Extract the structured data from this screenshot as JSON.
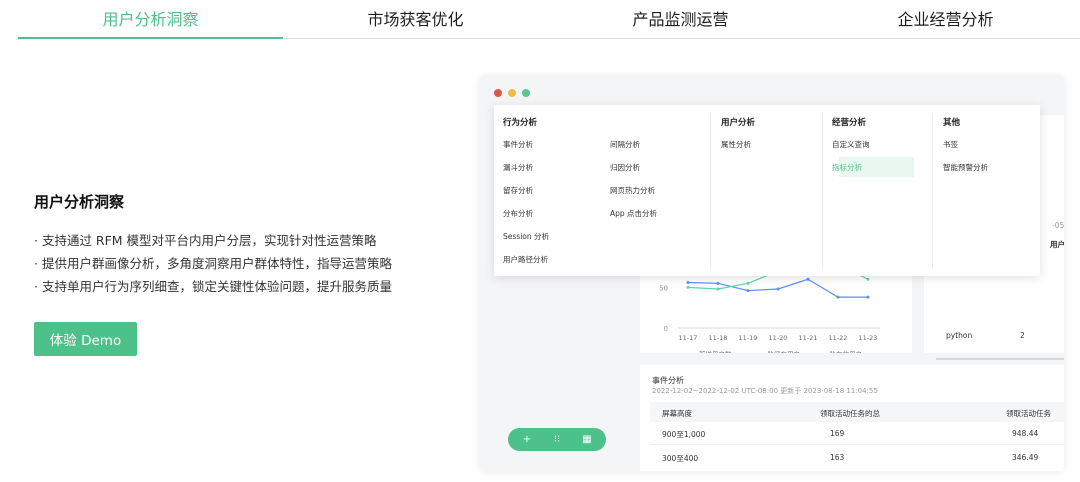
{
  "tabs": [
    {
      "label": "用户分析洞察"
    },
    {
      "label": "市场获客优化"
    },
    {
      "label": "产品监测运营"
    },
    {
      "label": "企业经营分析"
    }
  ],
  "intro": {
    "title": "用户分析洞察",
    "bullets": [
      "· 支持通过 RFM 模型对平台内用户分层，实现针对性运营策略",
      "· 提供用户群画像分析，多角度洞察用户群体特性，指导运营策略",
      "· 支持单用户行为序列细查，锁定关键性体验问题，提升服务质量"
    ],
    "demo_button": "体验 Demo"
  },
  "colors": {
    "accent": "#4cc18a",
    "line_blue": "#5b8ff9",
    "line_green": "#5ad8a6",
    "line_yellow": "#f6bd16"
  },
  "menu": {
    "behavior": {
      "head": "行为分析",
      "col1": [
        "事件分析",
        "漏斗分析",
        "留存分析",
        "分布分析",
        "Session 分析",
        "用户路径分析"
      ],
      "col2": [
        "间隔分析",
        "归因分析",
        "网页热力分析",
        "App 点击分析"
      ]
    },
    "user": {
      "head": "用户分析",
      "items": [
        "属性分析"
      ]
    },
    "business": {
      "head": "经营分析",
      "items": [
        "自定义查询",
        "指标分析"
      ]
    },
    "other": {
      "head": "其他",
      "items": [
        "书签",
        "智能预警分析"
      ]
    }
  },
  "chart_data": {
    "type": "line",
    "categories": [
      "11-17",
      "11-18",
      "11-19",
      "11-20",
      "11-21",
      "11-22",
      "11-23"
    ],
    "y_ticks": [
      "50",
      "0"
    ],
    "ylim": [
      0,
      80
    ],
    "series": [
      {
        "name": "新增用户数",
        "color": "#5b8ff9",
        "values": [
          56,
          55,
          46,
          48,
          60,
          38,
          38
        ]
      },
      {
        "name": "一阶留存用户",
        "color": "#5ad8a6",
        "values": [
          50,
          48,
          55,
          70,
          78,
          78,
          60
        ]
      },
      {
        "name": "一阶有效用户",
        "color": "#f6bd16",
        "values": [
          null,
          null,
          null,
          null,
          null,
          null,
          null
        ]
      }
    ]
  },
  "right_card": {
    "top_label": "-05",
    "header_frag": "用户",
    "row_name": "python",
    "row_value": "2"
  },
  "events": {
    "title": "事件分析",
    "subtitle": "2022-12-02~2022-12-02 UTC-08:00 更新于 2023-08-18 11:04:55",
    "columns": [
      "屏幕高度",
      "领取活动任务的总",
      "领取活动任务"
    ],
    "rows": [
      [
        "900至1,000",
        "169",
        "948.44"
      ],
      [
        "300至400",
        "163",
        "346.49"
      ]
    ]
  },
  "toolbar": {
    "plus": "+",
    "settings": "⁝⁝",
    "grid": "▦"
  }
}
